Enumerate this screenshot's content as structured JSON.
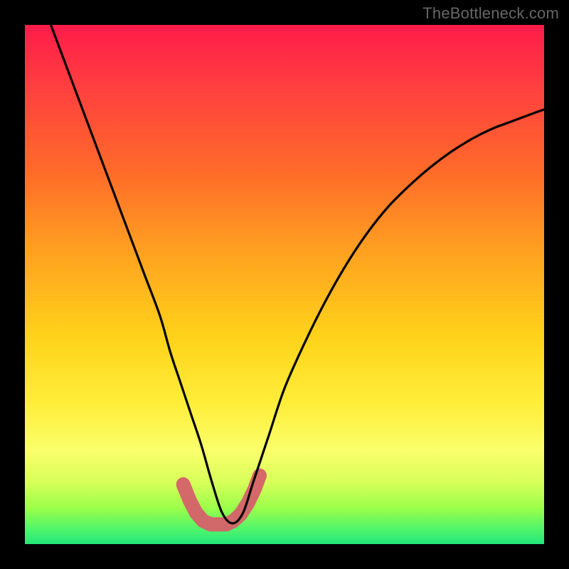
{
  "watermark": "TheBottleneck.com",
  "chart_data": {
    "type": "line",
    "title": "",
    "xlabel": "",
    "ylabel": "",
    "xlim": [
      0,
      100
    ],
    "ylim": [
      0,
      100
    ],
    "series": [
      {
        "name": "bottleneck-curve",
        "x": [
          5,
          8,
          11,
          14,
          17,
          20,
          23,
          26,
          28,
          30,
          32,
          34,
          36,
          38,
          40,
          42,
          44,
          47,
          50,
          54,
          58,
          62,
          66,
          70,
          74,
          78,
          82,
          86,
          90,
          94,
          98,
          100
        ],
        "y": [
          100,
          92,
          84,
          76,
          68,
          60,
          52,
          44,
          37,
          31,
          25,
          19,
          12,
          6,
          4,
          6,
          12,
          21,
          30,
          39,
          47,
          54,
          60,
          65,
          69,
          72.5,
          75.5,
          78,
          80,
          81.5,
          83,
          83.7
        ]
      },
      {
        "name": "highlight-bottom",
        "x": [
          30.5,
          31.7,
          33.0,
          34.3,
          35.8,
          37.2,
          38.0,
          38.8,
          40.2,
          41.6,
          43.0,
          44.2,
          45.2
        ],
        "y": [
          11.5,
          8.5,
          6.0,
          4.5,
          3.8,
          3.8,
          3.8,
          3.8,
          4.5,
          5.8,
          8.0,
          10.5,
          13.2
        ]
      }
    ],
    "colors": {
      "curve": "#000000",
      "highlight": "#d6606a"
    }
  }
}
